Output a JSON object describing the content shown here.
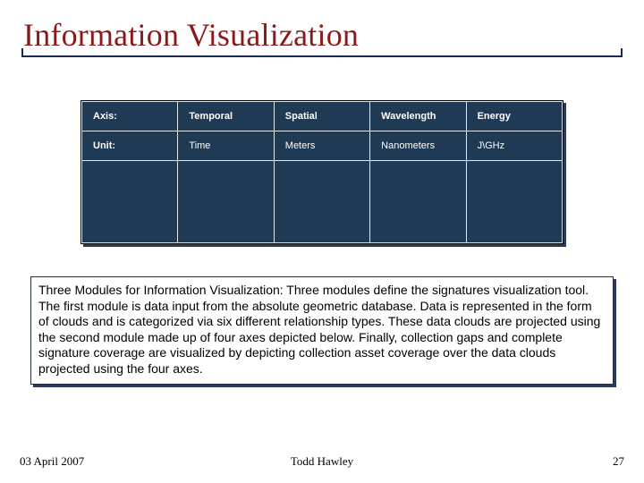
{
  "title": "Information Visualization",
  "chart_data": {
    "type": "table",
    "columns": [
      "",
      "Temporal",
      "Spatial",
      "Wavelength",
      "Energy"
    ],
    "rows": [
      {
        "label": "Axis:",
        "cells": [
          "Temporal",
          "Spatial",
          "Wavelength",
          "Energy"
        ]
      },
      {
        "label": "Unit:",
        "cells": [
          "Time",
          "Meters",
          "Nanometers",
          "J\\GHz"
        ]
      }
    ]
  },
  "description": {
    "lead": "Three Modules for Information Visualization:",
    "body": "  Three modules define the signatures visualization tool. The first module is data input from the absolute geometric database. Data is represented in the form of clouds and is categorized via six different relationship types.  These data clouds are projected using the second module made up of four axes depicted below.  Finally, collection gaps and complete signature coverage are visualized by depicting collection asset coverage over the data clouds projected using the four axes."
  },
  "footer": {
    "date": "03 April 2007",
    "author": "Todd Hawley",
    "page": "27"
  }
}
